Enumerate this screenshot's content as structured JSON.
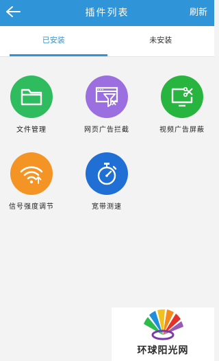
{
  "header": {
    "title": "插件列表",
    "refresh_label": "刷新"
  },
  "tabs": [
    {
      "label": "已安装"
    },
    {
      "label": "未安装"
    }
  ],
  "colors": {
    "accent": "#2f94d8"
  },
  "plugins": [
    {
      "label": "文件管理",
      "icon": "folder-icon",
      "color": "#2fbc5e"
    },
    {
      "label": "网页广告拦截",
      "icon": "webpage-filter-icon",
      "color": "#9b6fe0"
    },
    {
      "label": "视频广告屏蔽",
      "icon": "tv-cut-icon",
      "color": "#27b53f"
    },
    {
      "label": "信号强度调节",
      "icon": "wifi-signal-icon",
      "color": "#f39425"
    },
    {
      "label": "宽带测速",
      "icon": "stopwatch-icon",
      "color": "#1f6fd4"
    }
  ],
  "watermark": {
    "text": "环球阳光网"
  }
}
